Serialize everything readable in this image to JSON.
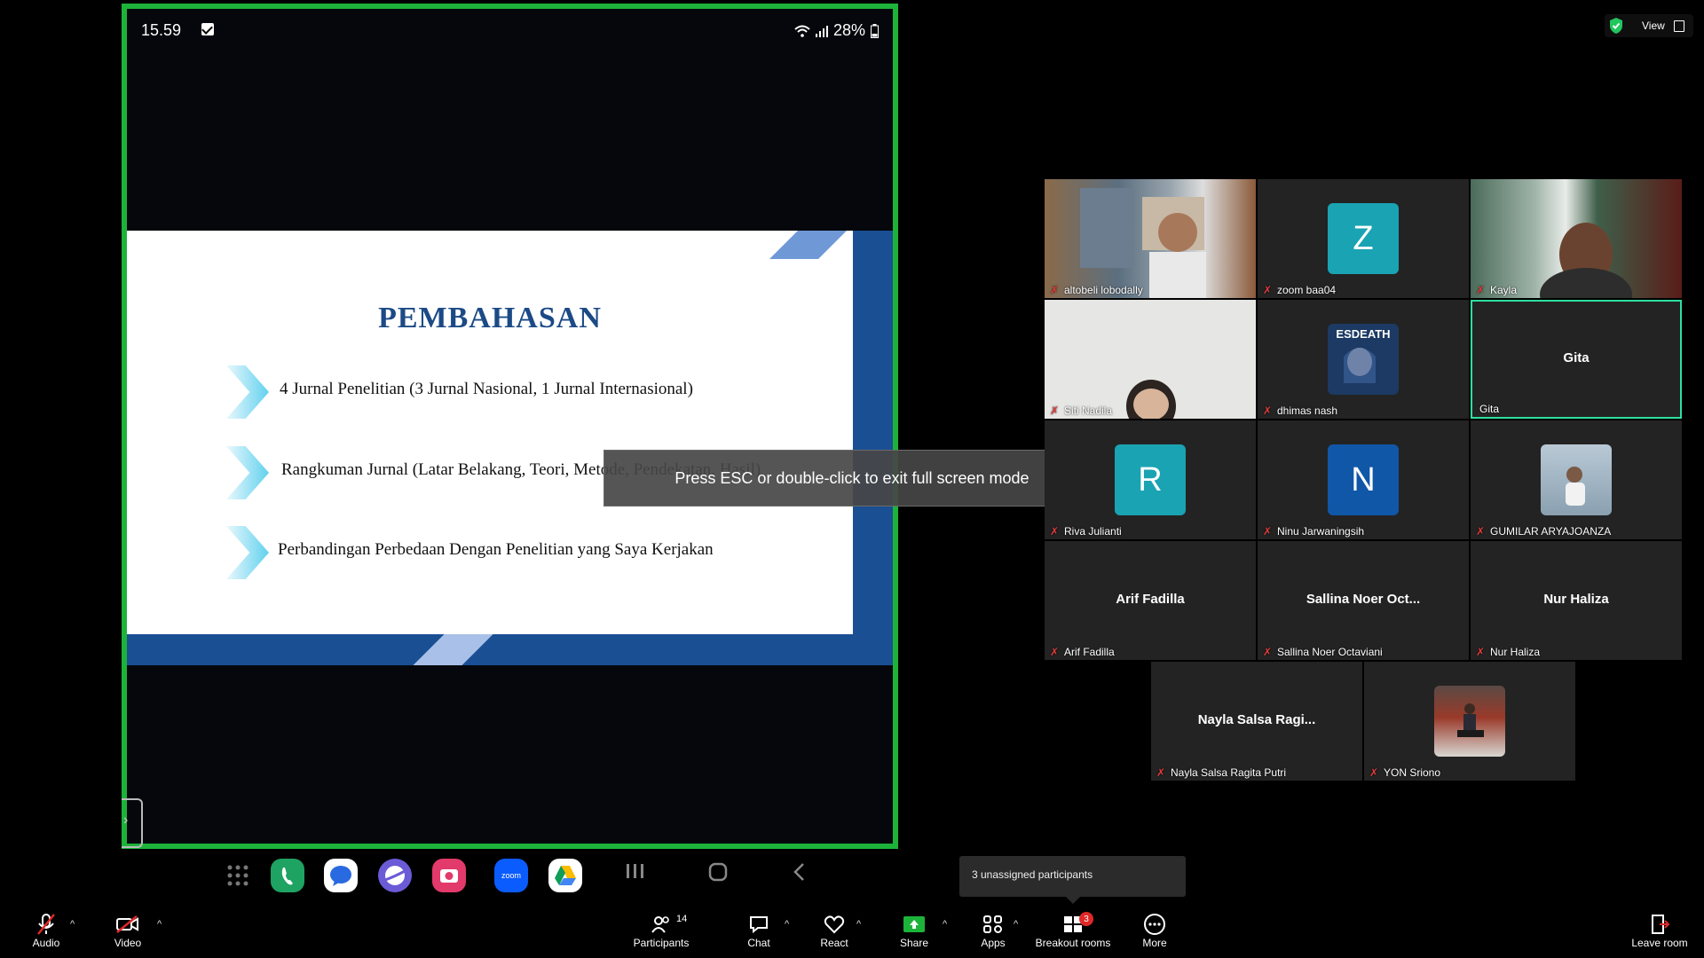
{
  "phone": {
    "time": "15.59",
    "battery": "28%",
    "slide": {
      "title": "PEMBAHASAN",
      "bullets": [
        "4 Jurnal Penelitian (3 Jurnal Nasional, 1 Jurnal Internasional)",
        "Rangkuman Jurnal (Latar Belakang, Teori, Metode, Pendekatan, Hasil)",
        "Perbandingan Perbedaan Dengan Penelitian yang Saya Kerjakan"
      ]
    },
    "dock": {
      "apps": [
        "apps-grid-icon",
        "phone-icon",
        "messages-icon",
        "internet-icon",
        "camera-icon",
        "zoom-icon",
        "drive-icon"
      ],
      "zoom_label": "zoom"
    }
  },
  "fullscreen_toast": "Press ESC or double-click to exit full screen mode",
  "view_button": {
    "label": "View"
  },
  "participants": [
    {
      "name": "altobeli lobodally",
      "type": "video"
    },
    {
      "name": "zoom baa04",
      "type": "letter",
      "letter": "Z",
      "color": "#1aa3b3"
    },
    {
      "name": "Kayla",
      "type": "video"
    },
    {
      "name": "Siti Nadila",
      "type": "video"
    },
    {
      "name": "dhimas nash",
      "type": "image",
      "image_text": "ESDEATH"
    },
    {
      "name": "Gita",
      "type": "name",
      "display": "Gita",
      "active": true
    },
    {
      "name": "Riva Julianti",
      "type": "letter",
      "letter": "R",
      "color": "#1aa3b3"
    },
    {
      "name": "Ninu Jarwaningsih",
      "type": "letter",
      "letter": "N",
      "color": "#1057a8"
    },
    {
      "name": "GUMILAR ARYAJOANZA",
      "type": "image"
    },
    {
      "name": "Arif Fadilla",
      "type": "name",
      "display": "Arif Fadilla"
    },
    {
      "name": "Sallina Noer Octaviani",
      "type": "name",
      "display": "Sallina  Noer  Oct..."
    },
    {
      "name": "Nur Haliza",
      "type": "name",
      "display": "Nur Haliza"
    },
    {
      "name": "Nayla Salsa Ragita Putri",
      "type": "name",
      "display": "Nayla  Salsa  Ragi..."
    },
    {
      "name": "YON Sriono",
      "type": "image"
    }
  ],
  "unassigned_popup": "3 unassigned participants",
  "toolbar": {
    "audio": "Audio",
    "video": "Video",
    "participants": "Participants",
    "participants_count": "14",
    "chat": "Chat",
    "react": "React",
    "share": "Share",
    "apps": "Apps",
    "breakout": "Breakout rooms",
    "breakout_badge": "3",
    "more": "More",
    "leave": "Leave room"
  },
  "colors": {
    "share_border": "#1db33a",
    "slide_title": "#1c4a86",
    "active_speaker": "#2de0a0",
    "share_green": "#1db33a"
  }
}
